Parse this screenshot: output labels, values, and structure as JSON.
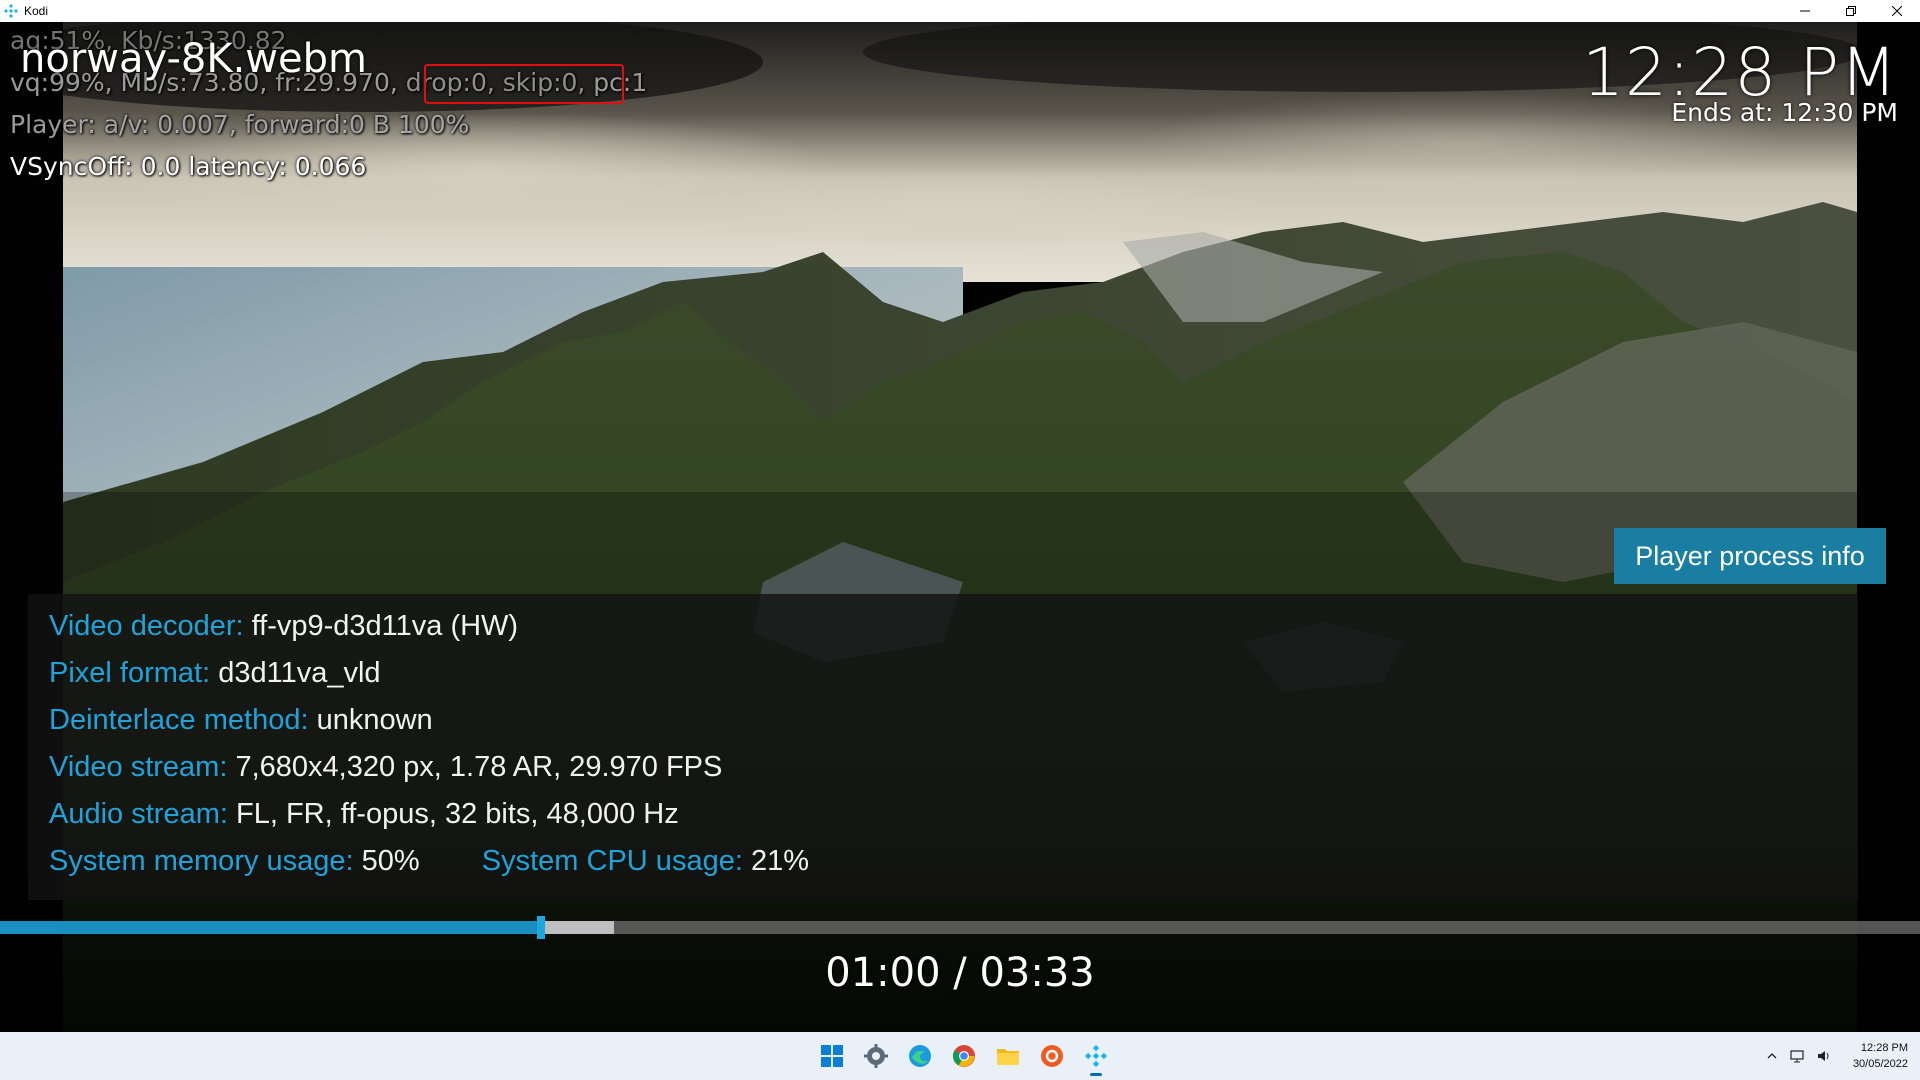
{
  "window": {
    "title": "Kodi"
  },
  "debug": {
    "line1": "aq:51%, Kb/s:1330.82",
    "line2_pre": "vq:99%, Mb/s:73.80, fr:29.970, ",
    "line2_highlight": "drop:0, skip:0,",
    "line2_post": " pc:1",
    "line3": "Player: a/v: 0.007,  forward:0 B 100%",
    "line4": "VSyncOff: 0.0 latency: 0.066"
  },
  "osd": {
    "media_title": "norway-8K.webm",
    "clock": "12:28 PM",
    "ends_at": "Ends at: 12:30 PM",
    "process_button": "Player process info",
    "time": "01:00 / 03:33",
    "progress_fraction": 0.2817,
    "buffer_fraction": 0.32
  },
  "info": {
    "video_decoder_label": "Video decoder:",
    "video_decoder_value": "ff-vp9-d3d11va (HW)",
    "pixel_format_label": "Pixel format:",
    "pixel_format_value": "d3d11va_vld",
    "deinterlace_label": "Deinterlace method:",
    "deinterlace_value": "unknown",
    "video_stream_label": "Video stream:",
    "video_stream_value": "7,680x4,320 px, 1.78 AR, 29.970 FPS",
    "audio_stream_label": "Audio stream:",
    "audio_stream_value": "FL, FR, ff-opus, 32 bits, 48,000 Hz",
    "memory_label": "System memory usage:",
    "memory_value": "50%",
    "cpu_label": "System CPU usage:",
    "cpu_value": "21%"
  },
  "taskbar": {
    "apps": [
      "windows-start-icon",
      "settings-icon",
      "edge-browser-icon",
      "chrome-browser-icon",
      "file-explorer-icon",
      "brave-browser-icon",
      "kodi-icon"
    ],
    "time": "12:28 PM",
    "date": "30/05/2022"
  },
  "colors": {
    "accent": "#1a8fbf",
    "label": "#1fa3d9",
    "highlight_box": "#e01010",
    "taskbar": "#eaf0f8"
  }
}
